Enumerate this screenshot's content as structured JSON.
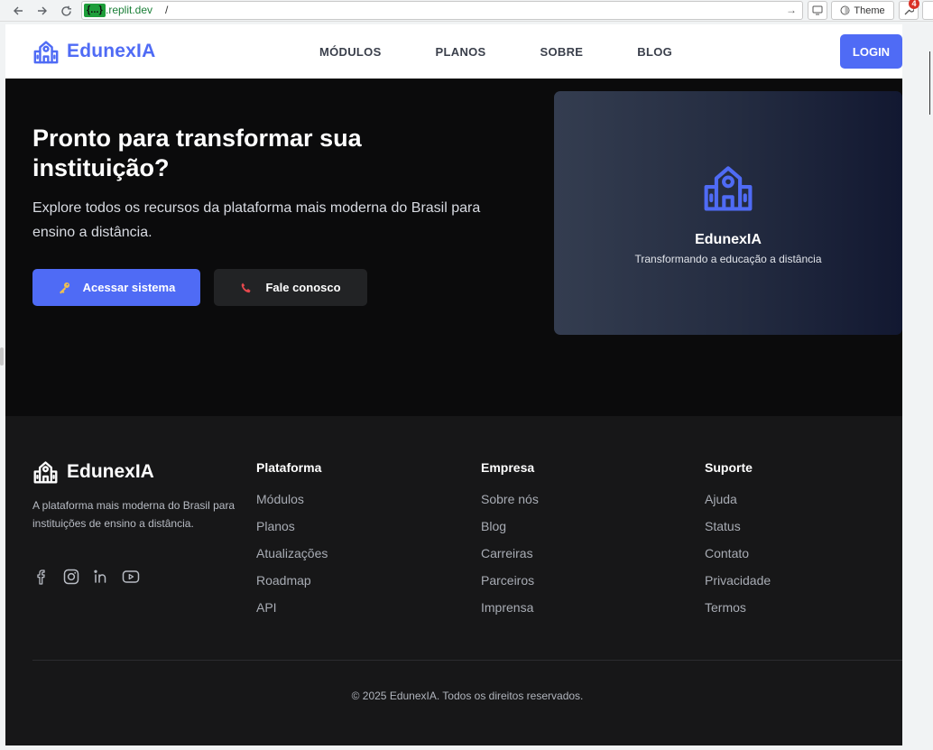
{
  "browser": {
    "url_badge": "{...}",
    "url_host": ".replit.dev",
    "url_path": "/",
    "theme_label": "Theme",
    "ext_badge_count": "4"
  },
  "navbar": {
    "brand": "EdunexIA",
    "links": [
      "MÓDULOS",
      "PLANOS",
      "SOBRE",
      "BLOG"
    ],
    "login": "LOGIN"
  },
  "hero": {
    "title": "Pronto para transformar sua instituição?",
    "subtitle": "Explore todos os recursos da plataforma mais moderna do Brasil para ensino a distância.",
    "primary_button": "Acessar sistema",
    "secondary_button": "Fale conosco",
    "card_title": "EdunexIA",
    "card_subtitle": "Transformando a educação a distância"
  },
  "footer": {
    "brand": "EdunexIA",
    "description": "A plataforma mais moderna do Brasil para instituições de ensino a distância.",
    "socials": [
      "facebook-icon",
      "instagram-icon",
      "linkedin-icon",
      "youtube-icon"
    ],
    "columns": [
      {
        "title": "Plataforma",
        "links": [
          "Módulos",
          "Planos",
          "Atualizações",
          "Roadmap",
          "API"
        ]
      },
      {
        "title": "Empresa",
        "links": [
          "Sobre nós",
          "Blog",
          "Carreiras",
          "Parceiros",
          "Imprensa"
        ]
      },
      {
        "title": "Suporte",
        "links": [
          "Ajuda",
          "Status",
          "Contato",
          "Privacidade",
          "Termos"
        ]
      }
    ],
    "copyright": "© 2025 EdunexIA. Todos os direitos reservados."
  },
  "colors": {
    "accent": "#4f6bf5",
    "hero_bg": "#0b0b0c",
    "footer_bg": "#171718",
    "key_icon": "#f2c14e",
    "phone_icon": "#e5484d"
  }
}
